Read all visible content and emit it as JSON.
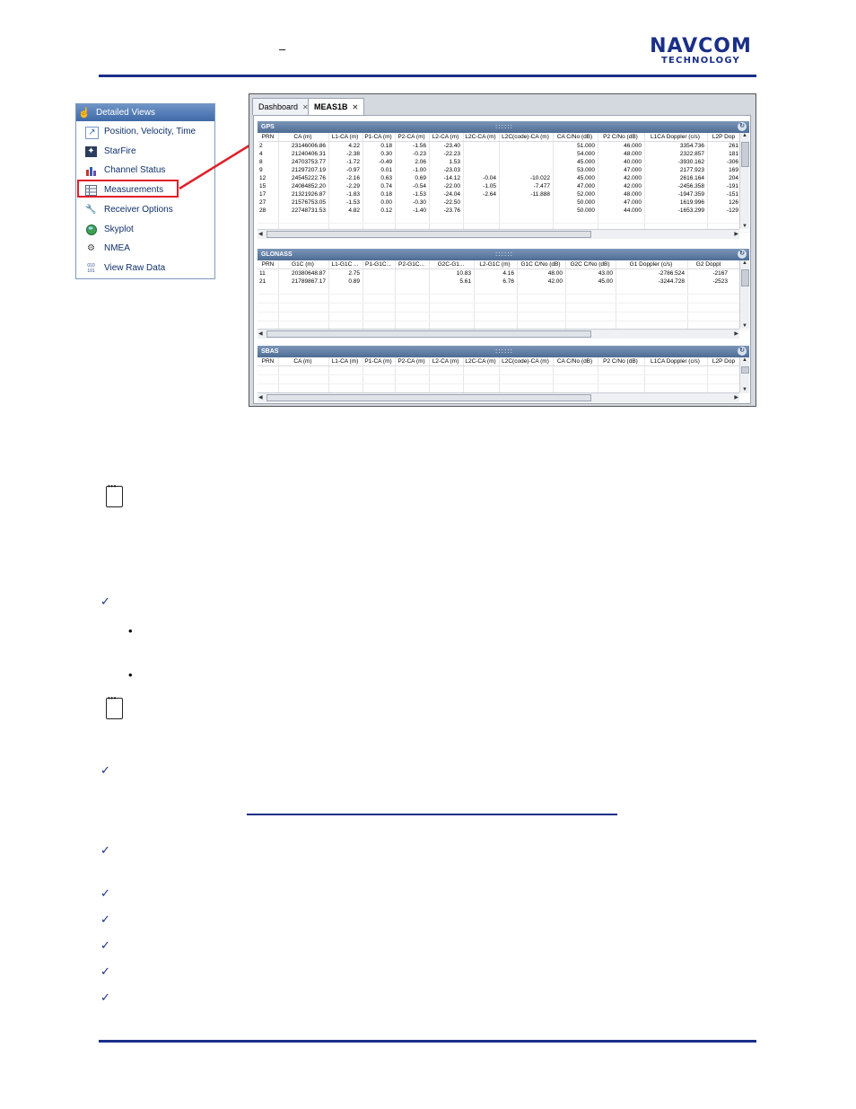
{
  "header": {
    "dash": "–",
    "logo_line1": "NAVCOM",
    "logo_line2": "TECHNOLOGY"
  },
  "side_panel": {
    "title": "Detailed Views",
    "items": [
      {
        "label": "Position, Velocity, Time",
        "icon": "pvt-chart-icon"
      },
      {
        "label": "StarFire",
        "icon": "satellite-icon"
      },
      {
        "label": "Channel Status",
        "icon": "bar-chart-icon"
      },
      {
        "label": "Measurements",
        "icon": "table-grid-icon"
      },
      {
        "label": "Receiver Options",
        "icon": "wrench-icon"
      },
      {
        "label": "Skyplot",
        "icon": "globe-icon"
      },
      {
        "label": "NMEA",
        "icon": "gear-icon"
      },
      {
        "label": "View Raw Data",
        "icon": "binary-icon"
      }
    ]
  },
  "window": {
    "tabs": [
      {
        "label": "Dashboard"
      },
      {
        "label": "MEAS1B"
      }
    ],
    "gps": {
      "title": "GPS",
      "columns": [
        "PRN",
        "CA (m)",
        "L1-CA (m)",
        "P1-CA (m)",
        "P2-CA (m)",
        "L2-CA (m)",
        "L2C-CA (m)",
        "L2C(code)-CA (m)",
        "CA C/No (dB)",
        "P2 C/No (dB)",
        "L1CA Doppler (c/s)",
        "L2P Dop"
      ],
      "rows": [
        [
          "2",
          "23146006.86",
          "4.22",
          "0.18",
          "-1.56",
          "-23.40",
          "",
          "",
          "51.000",
          "46.000",
          "3354.736",
          "261"
        ],
        [
          "4",
          "21240406.31",
          "-2.38",
          "0.30",
          "-0.23",
          "-22.23",
          "",
          "",
          "54.000",
          "48.000",
          "2322.857",
          "181"
        ],
        [
          "8",
          "24703753.77",
          "-1.72",
          "-0.49",
          "2.06",
          "1.53",
          "",
          "",
          "45.000",
          "40.000",
          "-3930.162",
          "-306"
        ],
        [
          "9",
          "21297207.19",
          "-0.97",
          "0.01",
          "-1.00",
          "-23.03",
          "",
          "",
          "53.000",
          "47.000",
          "2177.923",
          "169"
        ],
        [
          "12",
          "24545222.76",
          "-2.16",
          "0.63",
          "0.69",
          "-14.12",
          "-0.04",
          "-10.022",
          "45.000",
          "42.000",
          "2616.164",
          "204"
        ],
        [
          "15",
          "24084852.20",
          "-2.29",
          "0.74",
          "-0.54",
          "-22.00",
          "-1.05",
          "-7.477",
          "47.000",
          "42.000",
          "-2456.358",
          "-191"
        ],
        [
          "17",
          "21321926.87",
          "-1.83",
          "0.18",
          "-1.53",
          "-24.04",
          "-2.64",
          "-11.888",
          "52.000",
          "48.000",
          "-1947.359",
          "-151"
        ],
        [
          "27",
          "21576753.05",
          "-1.53",
          "0.00",
          "-0.30",
          "-22.50",
          "",
          "",
          "50.000",
          "47.000",
          "1619.996",
          "126"
        ],
        [
          "28",
          "22748731.53",
          "4.82",
          "0.12",
          "-1.40",
          "-23.76",
          "",
          "",
          "50.000",
          "44.000",
          "-1653.299",
          "-129"
        ]
      ]
    },
    "glonass": {
      "title": "GLONASS",
      "columns": [
        "PRN",
        "G1C (m)",
        "L1-G1C ...",
        "P1-G1C...",
        "P2-G1C...",
        "G2C-G1...",
        "L2-G1C (m)",
        "G1C C/No (dB)",
        "G2C C/No (dB)",
        "G1 Doppler (c/s)",
        "G2 Doppl"
      ],
      "rows": [
        [
          "11",
          "20380648.87",
          "2.75",
          "",
          "",
          "10.83",
          "4.16",
          "48.00",
          "43.00",
          "-2786.524",
          "-2167"
        ],
        [
          "21",
          "21789867.17",
          "0.89",
          "",
          "",
          "5.61",
          "6.76",
          "42.00",
          "45.00",
          "-3244.728",
          "-2523"
        ]
      ]
    },
    "sbas": {
      "title": "SBAS",
      "columns": [
        "PRN",
        "CA (m)",
        "L1-CA (m)",
        "P1-CA (m)",
        "P2-CA (m)",
        "L2-CA (m)",
        "L2C-CA (m)",
        "L2C(code)-CA (m)",
        "CA C/No (dB)",
        "P2 C/No (dB)",
        "L1CA Doppler (c/s)",
        "L2P Dop"
      ]
    }
  },
  "body": {
    "checks": [
      "✓",
      "✓",
      "✓",
      "✓",
      "✓",
      "✓",
      "✓",
      "✓"
    ],
    "bullets": [
      "•",
      "•"
    ]
  },
  "colors": {
    "brand_blue": "#1a2f88",
    "highlight_red": "#e0202a"
  }
}
